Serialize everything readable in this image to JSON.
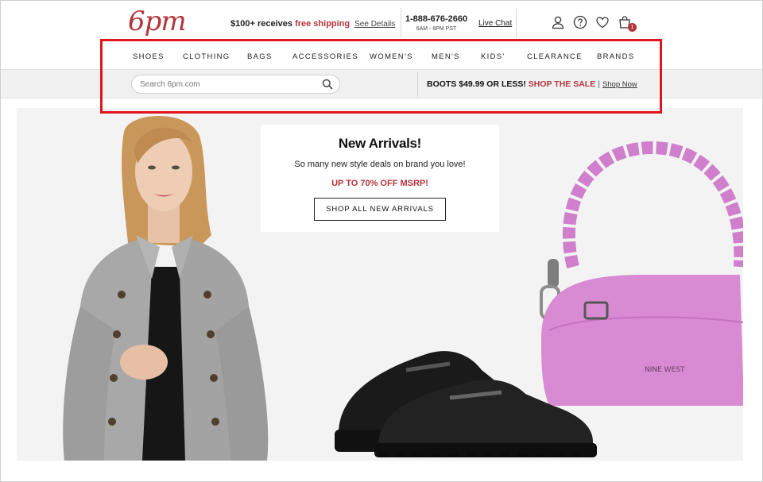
{
  "header": {
    "logo": "6pm",
    "shipping_prefix": "$100+ receives ",
    "shipping_free": "free shipping",
    "shipping_link": "See Details",
    "phone": "1-888-676-2660",
    "hours": "6AM - 8PM PST",
    "chat": "Live Chat",
    "icons": [
      "user-icon",
      "help-icon",
      "heart-icon",
      "cart-icon"
    ],
    "cart_count": "1"
  },
  "nav": {
    "items": [
      "SHOES",
      "CLOTHING",
      "BAGS",
      "ACCESSORIES",
      "WOMEN'S",
      "MEN'S",
      "KIDS'",
      "CLEARANCE",
      "BRANDS"
    ]
  },
  "search": {
    "placeholder": "Search 6pm.com"
  },
  "promo": {
    "main": "BOOTS $49.99 OR LESS!",
    "sale": "SHOP THE SALE",
    "link": "Shop Now"
  },
  "hero": {
    "title": "New Arrivals!",
    "subtitle": "So many new style deals on brand you love!",
    "offer": "UP TO 70% OFF MSRP!",
    "cta": "SHOP ALL NEW ARRIVALS",
    "bag_brand": "NINE WEST"
  },
  "colors": {
    "brand": "#b5343c",
    "highlight": "#e0161e",
    "bag": "#d88ad2"
  }
}
